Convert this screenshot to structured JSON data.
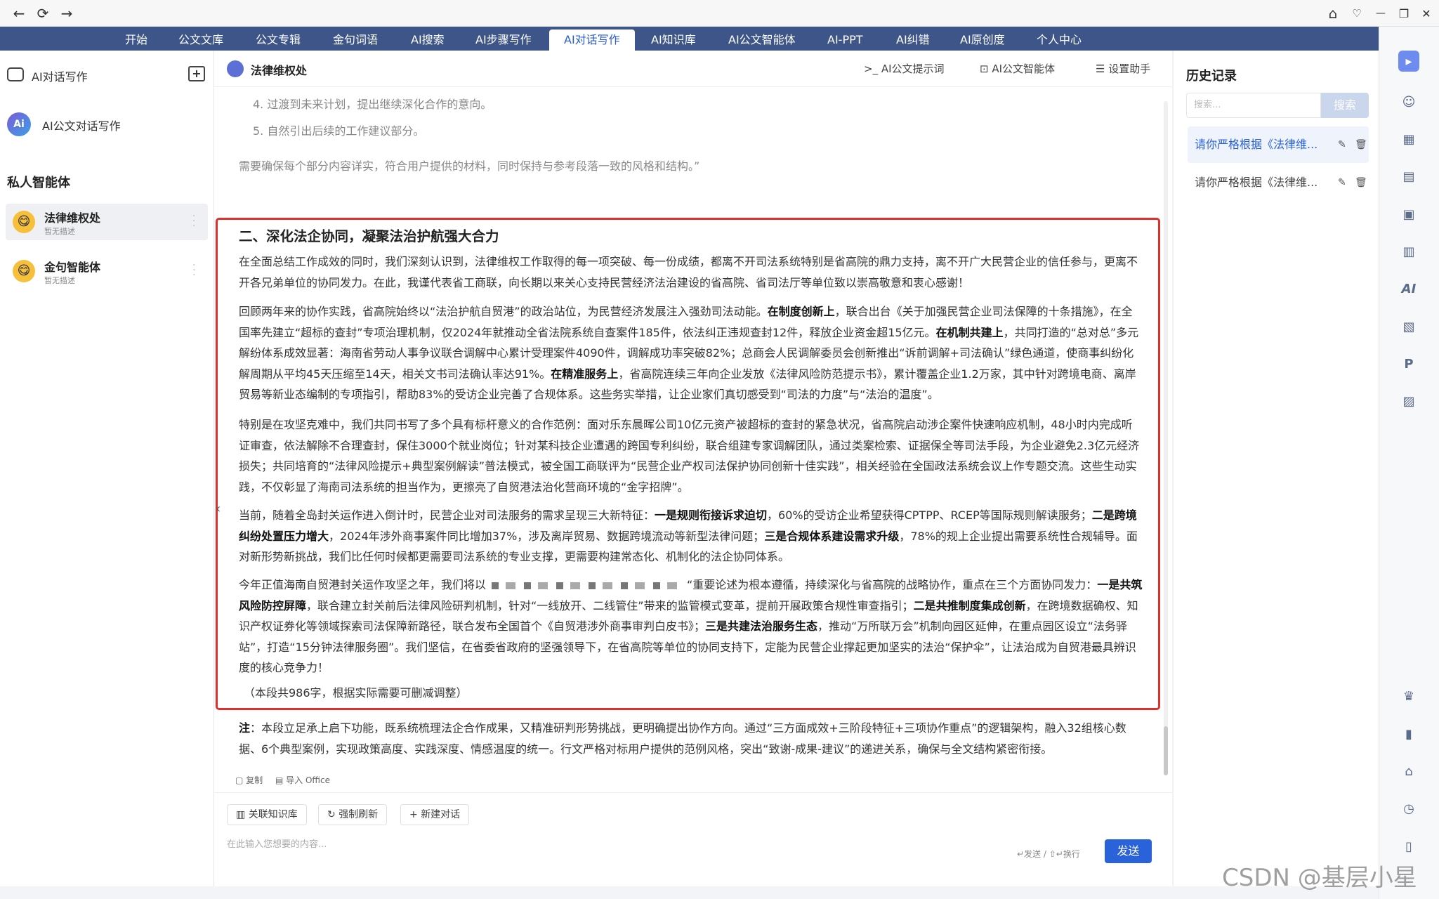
{
  "titlebar": {
    "back": "←",
    "reload": "⟳",
    "forward": "→",
    "home": "⌂",
    "pin": "♡",
    "minimize": "—",
    "restore": "❐",
    "close": "✕"
  },
  "nav": [
    "开始",
    "公文文库",
    "公文专辑",
    "金句词语",
    "AI搜索",
    "AI步骤写作",
    "AI对话写作",
    "AI知识库",
    "AI公文智能体",
    "AI-PPT",
    "AI纠错",
    "AI原创度",
    "个人中心"
  ],
  "sidebar": {
    "header": "AI对话写作",
    "ai_item": "AI公文对话写作",
    "section": "私人智能体",
    "agents": [
      {
        "name": "法律维权处",
        "desc": "暂无描述"
      },
      {
        "name": "金句智能体",
        "desc": "暂无描述"
      }
    ]
  },
  "chat_header": {
    "title": "法律维权处",
    "prompt": "AI公文提示词",
    "agent": "AI公文智能体",
    "settings": "设置助手"
  },
  "content": {
    "list4": "4.  过渡到未来计划，提出继续深化合作的意向。",
    "list5": "5.  自然引出后续的工作建议部分。",
    "note_quote": "需要确保每个部分内容详实，符合用户提供的材料，同时保持与参考段落一致的风格和结构。”",
    "section_title": "二、深化法企协同，凝聚法治护航强大合力",
    "p1": "在全面总结工作成效的同时，我们深刻认识到，法律维权工作取得的每一项突破、每一份成绩，都离不开司法系统特别是省高院的鼎力支持，离不开广大民营企业的信任参与，更离不开各兄弟单位的协同发力。在此，我谨代表省工商联，向长期以来关心支持民营经济法治建设的省高院、省司法厅等单位致以崇高敬意和衷心感谢！",
    "p2a": "回顾两年来的协作实践，省高院始终以“法治护航自贸港”的政治站位，为民营经济发展注入强劲司法动能。",
    "p2b": "在制度创新上",
    "p2c": "，联合出台《关于加强民营企业司法保障的十条措施》，在全国率先建立“超标的查封”专项治理机制，仅2024年就推动全省法院系统自查案件185件，依法纠正违规查封12件，释放企业资金超15亿元。",
    "p2d": "在机制共建上",
    "p2e": "，共同打造的“总对总”多元解纷体系成效显著：海南省劳动人事争议联合调解中心累计受理案件4090件，调解成功率突破82%；总商会人民调解委员会创新推出“诉前调解+司法确认”绿色通道，使商事纠纷化解周期从平均45天压缩至14天，相关文书司法确认率达91%。",
    "p2f": "在精准服务上",
    "p2g": "，省高院连续三年向企业发放《法律风险防范提示书》，累计覆盖企业1.2万家，其中针对跨境电商、离岸贸易等新业态编制的专项指引，帮助83%的受访企业完善了合规体系。这些务实举措，让企业家们真切感受到“司法的力度”与“法治的温度”。",
    "p3": "特别是在攻坚克难中，我们共同书写了多个具有标杆意义的合作范例：面对乐东晨晖公司10亿元资产被超标的查封的紧急状况，省高院启动涉企案件快速响应机制，48小时内完成听证审查，依法解除不合理查封，保住3000个就业岗位；针对某科技企业遭遇的跨国专利纠纷，联合组建专家调解团队，通过类案检索、证据保全等司法手段，为企业避免2.3亿元经济损失；共同培育的“法律风险提示+典型案例解读”普法模式，被全国工商联评为“民营企业产权司法保护协同创新十佳实践”，相关经验在全国政法系统会议上作专题交流。这些生动实践，不仅彰显了海南司法系统的担当作为，更擦亮了自贸港法治化营商环境的“金字招牌”。",
    "p4a": "当前，随着全岛封关运作进入倒计时，民营企业对司法服务的需求呈现三大新特征：",
    "p4b": "一是规则衔接诉求迫切",
    "p4c": "，60%的受访企业希望获得CPTPP、RCEP等国际规则解读服务；",
    "p4d": "二是跨境纠纷处置压力增大",
    "p4e": "，2024年涉外商事案件同比增加37%，涉及离岸贸易、数据跨境流动等新型法律问题；",
    "p4f": "三是合规体系建设需求升级",
    "p4g": "，78%的规上企业提出需要系统性合规辅导。面对新形势新挑战，我们比任何时候都更需要司法系统的专业支撑，更需要构建常态化、机制化的法企协同体系。",
    "p5a": "今年正值海南自贸港封关运作攻坚之年，我们将以",
    "p5b": "“重要论述为根本遵循，持续深化与省高院的战略协作，重点在三个方面协同发力：",
    "p5c": "一是共筑风险防控屏障",
    "p5d": "，联合建立封关前后法律风险研判机制，针对“一线放开、二线管住”带来的监管模式变革，提前开展政策合规性审查指引；",
    "p5e": "二是共推制度集成创新",
    "p5f": "，在跨境数据确权、知识产权证券化等领域探索司法保障新路径，联合发布全国首个《自贸港涉外商事审判白皮书》；",
    "p5g": "三是共建法治服务生态",
    "p5h": "，推动“万所联万会”机制向园区延伸，在重点园区设立“法务驿站”，打造“15分钟法律服务圈”。我们坚信，在省委省政府的坚强领导下，在省高院等单位的协同支持下，定能为民营企业撑起更加坚实的法治“保护伞”，让法治成为自贸港最具辨识度的核心竞争力！",
    "wordcount": "（本段共986字，根据实际需要可删减调整）",
    "note_label": "注",
    "note_text": "：本段立足承上启下功能，既系统梳理法企合作成果，又精准研判形势挑战，更明确提出协作方向。通过“三方面成效+三阶段特征+三项协作重点”的逻辑架构，融入32组核心数据、6个典型案例，实现政策高度、实践深度、情感温度的统一。行文严格对标用户提供的范例风格，突出“致谢-成果-建议”的递进关系，确保与全文结构紧密衔接。"
  },
  "actions": {
    "copy": "复制",
    "import": "导入 Office"
  },
  "input": {
    "kb": "关联知识库",
    "refresh": "强制刷新",
    "new_chat": "新建对话",
    "placeholder": "在此输入您想要的内容...",
    "hint": "↵发送 / ⇧↵换行",
    "send": "发送"
  },
  "history": {
    "title": "历史记录",
    "search_placeholder": "搜索...",
    "search_btn": "搜索",
    "items": [
      "请你严格根据《法律维...",
      "请你严格根据《法律维..."
    ]
  },
  "watermark": "CSDN @基层小星"
}
